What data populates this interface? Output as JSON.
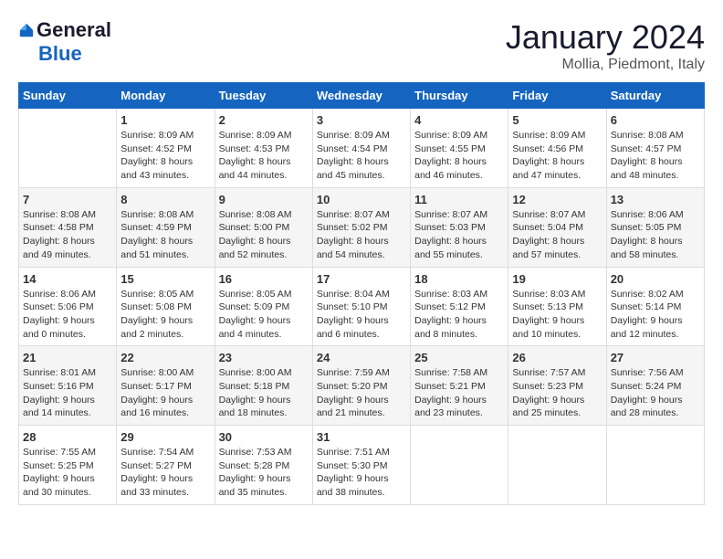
{
  "logo": {
    "general": "General",
    "blue": "Blue"
  },
  "title": "January 2024",
  "subtitle": "Mollia, Piedmont, Italy",
  "days_header": [
    "Sunday",
    "Monday",
    "Tuesday",
    "Wednesday",
    "Thursday",
    "Friday",
    "Saturday"
  ],
  "weeks": [
    [
      {
        "day": "",
        "info": ""
      },
      {
        "day": "1",
        "info": "Sunrise: 8:09 AM\nSunset: 4:52 PM\nDaylight: 8 hours\nand 43 minutes."
      },
      {
        "day": "2",
        "info": "Sunrise: 8:09 AM\nSunset: 4:53 PM\nDaylight: 8 hours\nand 44 minutes."
      },
      {
        "day": "3",
        "info": "Sunrise: 8:09 AM\nSunset: 4:54 PM\nDaylight: 8 hours\nand 45 minutes."
      },
      {
        "day": "4",
        "info": "Sunrise: 8:09 AM\nSunset: 4:55 PM\nDaylight: 8 hours\nand 46 minutes."
      },
      {
        "day": "5",
        "info": "Sunrise: 8:09 AM\nSunset: 4:56 PM\nDaylight: 8 hours\nand 47 minutes."
      },
      {
        "day": "6",
        "info": "Sunrise: 8:08 AM\nSunset: 4:57 PM\nDaylight: 8 hours\nand 48 minutes."
      }
    ],
    [
      {
        "day": "7",
        "info": "Sunrise: 8:08 AM\nSunset: 4:58 PM\nDaylight: 8 hours\nand 49 minutes."
      },
      {
        "day": "8",
        "info": "Sunrise: 8:08 AM\nSunset: 4:59 PM\nDaylight: 8 hours\nand 51 minutes."
      },
      {
        "day": "9",
        "info": "Sunrise: 8:08 AM\nSunset: 5:00 PM\nDaylight: 8 hours\nand 52 minutes."
      },
      {
        "day": "10",
        "info": "Sunrise: 8:07 AM\nSunset: 5:02 PM\nDaylight: 8 hours\nand 54 minutes."
      },
      {
        "day": "11",
        "info": "Sunrise: 8:07 AM\nSunset: 5:03 PM\nDaylight: 8 hours\nand 55 minutes."
      },
      {
        "day": "12",
        "info": "Sunrise: 8:07 AM\nSunset: 5:04 PM\nDaylight: 8 hours\nand 57 minutes."
      },
      {
        "day": "13",
        "info": "Sunrise: 8:06 AM\nSunset: 5:05 PM\nDaylight: 8 hours\nand 58 minutes."
      }
    ],
    [
      {
        "day": "14",
        "info": "Sunrise: 8:06 AM\nSunset: 5:06 PM\nDaylight: 9 hours\nand 0 minutes."
      },
      {
        "day": "15",
        "info": "Sunrise: 8:05 AM\nSunset: 5:08 PM\nDaylight: 9 hours\nand 2 minutes."
      },
      {
        "day": "16",
        "info": "Sunrise: 8:05 AM\nSunset: 5:09 PM\nDaylight: 9 hours\nand 4 minutes."
      },
      {
        "day": "17",
        "info": "Sunrise: 8:04 AM\nSunset: 5:10 PM\nDaylight: 9 hours\nand 6 minutes."
      },
      {
        "day": "18",
        "info": "Sunrise: 8:03 AM\nSunset: 5:12 PM\nDaylight: 9 hours\nand 8 minutes."
      },
      {
        "day": "19",
        "info": "Sunrise: 8:03 AM\nSunset: 5:13 PM\nDaylight: 9 hours\nand 10 minutes."
      },
      {
        "day": "20",
        "info": "Sunrise: 8:02 AM\nSunset: 5:14 PM\nDaylight: 9 hours\nand 12 minutes."
      }
    ],
    [
      {
        "day": "21",
        "info": "Sunrise: 8:01 AM\nSunset: 5:16 PM\nDaylight: 9 hours\nand 14 minutes."
      },
      {
        "day": "22",
        "info": "Sunrise: 8:00 AM\nSunset: 5:17 PM\nDaylight: 9 hours\nand 16 minutes."
      },
      {
        "day": "23",
        "info": "Sunrise: 8:00 AM\nSunset: 5:18 PM\nDaylight: 9 hours\nand 18 minutes."
      },
      {
        "day": "24",
        "info": "Sunrise: 7:59 AM\nSunset: 5:20 PM\nDaylight: 9 hours\nand 21 minutes."
      },
      {
        "day": "25",
        "info": "Sunrise: 7:58 AM\nSunset: 5:21 PM\nDaylight: 9 hours\nand 23 minutes."
      },
      {
        "day": "26",
        "info": "Sunrise: 7:57 AM\nSunset: 5:23 PM\nDaylight: 9 hours\nand 25 minutes."
      },
      {
        "day": "27",
        "info": "Sunrise: 7:56 AM\nSunset: 5:24 PM\nDaylight: 9 hours\nand 28 minutes."
      }
    ],
    [
      {
        "day": "28",
        "info": "Sunrise: 7:55 AM\nSunset: 5:25 PM\nDaylight: 9 hours\nand 30 minutes."
      },
      {
        "day": "29",
        "info": "Sunrise: 7:54 AM\nSunset: 5:27 PM\nDaylight: 9 hours\nand 33 minutes."
      },
      {
        "day": "30",
        "info": "Sunrise: 7:53 AM\nSunset: 5:28 PM\nDaylight: 9 hours\nand 35 minutes."
      },
      {
        "day": "31",
        "info": "Sunrise: 7:51 AM\nSunset: 5:30 PM\nDaylight: 9 hours\nand 38 minutes."
      },
      {
        "day": "",
        "info": ""
      },
      {
        "day": "",
        "info": ""
      },
      {
        "day": "",
        "info": ""
      }
    ]
  ]
}
